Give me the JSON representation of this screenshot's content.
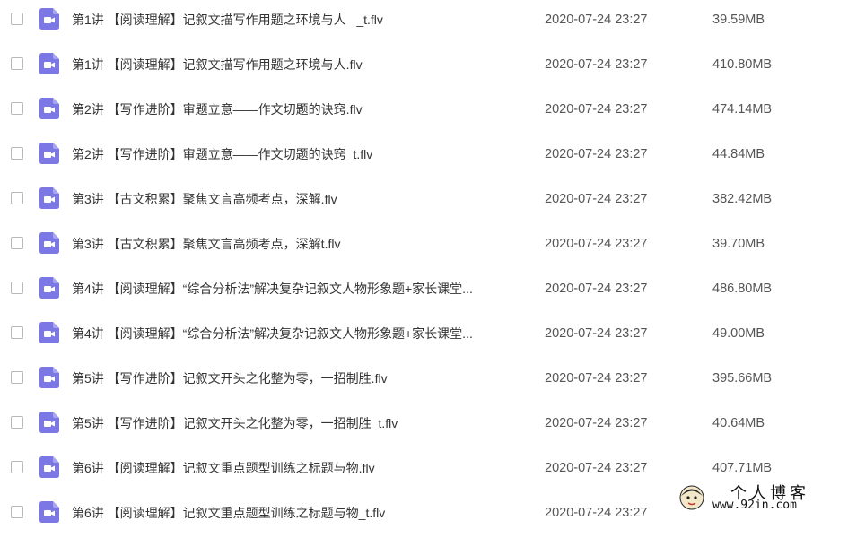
{
  "colors": {
    "icon_bg": "#7b78e6",
    "text": "#333333",
    "meta_text": "#555555"
  },
  "files": [
    {
      "name": "第1讲 【阅读理解】记叙文描写作用题之环境与人   _t.flv",
      "date": "2020-07-24 23:27",
      "size": "39.59MB",
      "icon": "video-file-icon"
    },
    {
      "name": "第1讲 【阅读理解】记叙文描写作用题之环境与人.flv",
      "date": "2020-07-24 23:27",
      "size": "410.80MB",
      "icon": "video-file-icon"
    },
    {
      "name": "第2讲 【写作进阶】审题立意——作文切题的诀窍.flv",
      "date": "2020-07-24 23:27",
      "size": "474.14MB",
      "icon": "video-file-icon"
    },
    {
      "name": "第2讲 【写作进阶】审题立意——作文切题的诀窍_t.flv",
      "date": "2020-07-24 23:27",
      "size": "44.84MB",
      "icon": "video-file-icon"
    },
    {
      "name": "第3讲 【古文积累】聚焦文言高频考点，深解.flv",
      "date": "2020-07-24 23:27",
      "size": "382.42MB",
      "icon": "video-file-icon"
    },
    {
      "name": "第3讲 【古文积累】聚焦文言高频考点，深解t.flv",
      "date": "2020-07-24 23:27",
      "size": "39.70MB",
      "icon": "video-file-icon"
    },
    {
      "name": "第4讲 【阅读理解】“综合分析法”解决复杂记叙文人物形象题+家长课堂...",
      "date": "2020-07-24 23:27",
      "size": "486.80MB",
      "icon": "video-file-icon"
    },
    {
      "name": "第4讲 【阅读理解】“综合分析法”解决复杂记叙文人物形象题+家长课堂...",
      "date": "2020-07-24 23:27",
      "size": "49.00MB",
      "icon": "video-file-icon"
    },
    {
      "name": "第5讲 【写作进阶】记叙文开头之化整为零，一招制胜.flv",
      "date": "2020-07-24 23:27",
      "size": "395.66MB",
      "icon": "video-file-icon"
    },
    {
      "name": "第5讲 【写作进阶】记叙文开头之化整为零，一招制胜_t.flv",
      "date": "2020-07-24 23:27",
      "size": "40.64MB",
      "icon": "video-file-icon"
    },
    {
      "name": "第6讲 【阅读理解】记叙文重点题型训练之标题与物.flv",
      "date": "2020-07-24 23:27",
      "size": "407.71MB",
      "icon": "video-file-icon"
    },
    {
      "name": "第6讲 【阅读理解】记叙文重点题型训练之标题与物_t.flv",
      "date": "2020-07-24 23:27",
      "size": "",
      "icon": "video-file-icon"
    }
  ],
  "watermark": {
    "title": "个人博客",
    "url": "www.92in.com"
  }
}
